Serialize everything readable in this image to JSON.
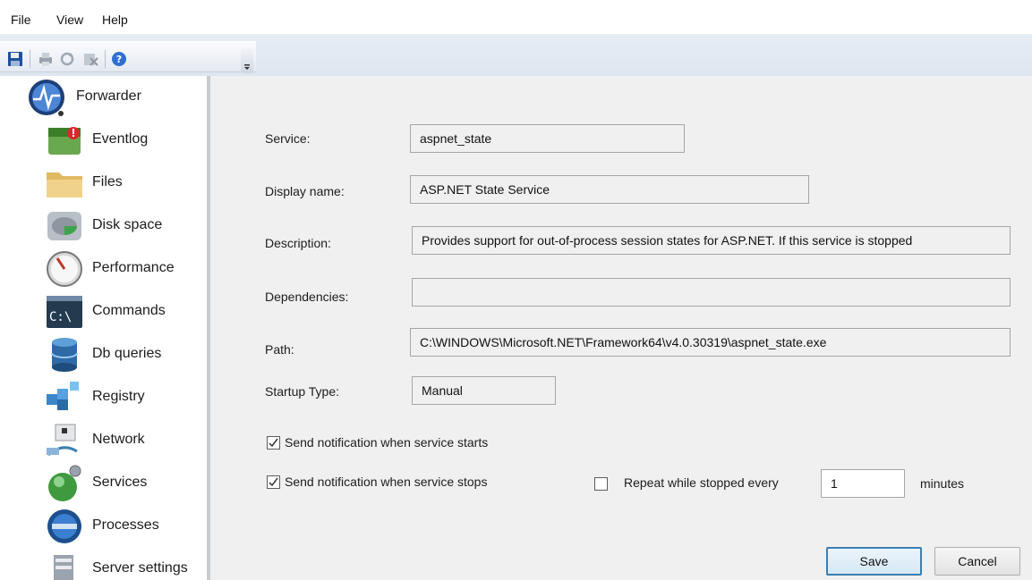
{
  "menu": {
    "file": "File",
    "view": "View",
    "help": "Help"
  },
  "toolbar": {
    "icons": [
      "save-icon",
      "print-icon",
      "refresh-icon",
      "delete-icon",
      "help-icon"
    ]
  },
  "sidebar": {
    "items": [
      {
        "label": "Forwarder",
        "icon": "forwarder-icon"
      },
      {
        "label": "Eventlog",
        "icon": "eventlog-icon"
      },
      {
        "label": "Files",
        "icon": "folder-icon"
      },
      {
        "label": "Disk space",
        "icon": "disk-icon"
      },
      {
        "label": "Performance",
        "icon": "gauge-icon"
      },
      {
        "label": "Commands",
        "icon": "console-icon"
      },
      {
        "label": "Db queries",
        "icon": "database-icon"
      },
      {
        "label": "Registry",
        "icon": "registry-icon"
      },
      {
        "label": "Network",
        "icon": "network-icon"
      },
      {
        "label": "Services",
        "icon": "services-icon"
      },
      {
        "label": "Processes",
        "icon": "processes-icon"
      },
      {
        "label": "Server settings",
        "icon": "server-icon"
      }
    ]
  },
  "form": {
    "service_label": "Service:",
    "service_value": "aspnet_state",
    "display_name_label": "Display name:",
    "display_name_value": "ASP.NET State Service",
    "description_label": "Description:",
    "description_value": "Provides support for out-of-process session states for ASP.NET. If this service is stopped",
    "dependencies_label": "Dependencies:",
    "dependencies_value": "",
    "path_label": "Path:",
    "path_value": "C:\\WINDOWS\\Microsoft.NET\\Framework64\\v4.0.30319\\aspnet_state.exe",
    "startup_label": "Startup Type:",
    "startup_value": "Manual",
    "notify_start_label": "Send notification when service starts",
    "notify_start_checked": true,
    "notify_stop_label": "Send notification when service stops",
    "notify_stop_checked": true,
    "repeat_label": "Repeat while stopped every",
    "repeat_checked": false,
    "repeat_value": "1",
    "minutes_label": "minutes"
  },
  "buttons": {
    "save": "Save",
    "cancel": "Cancel"
  },
  "colors": {
    "accent": "#3c7fb1",
    "sidebar_bg": "#ffffff",
    "panel_bg": "#f0f0f0"
  }
}
